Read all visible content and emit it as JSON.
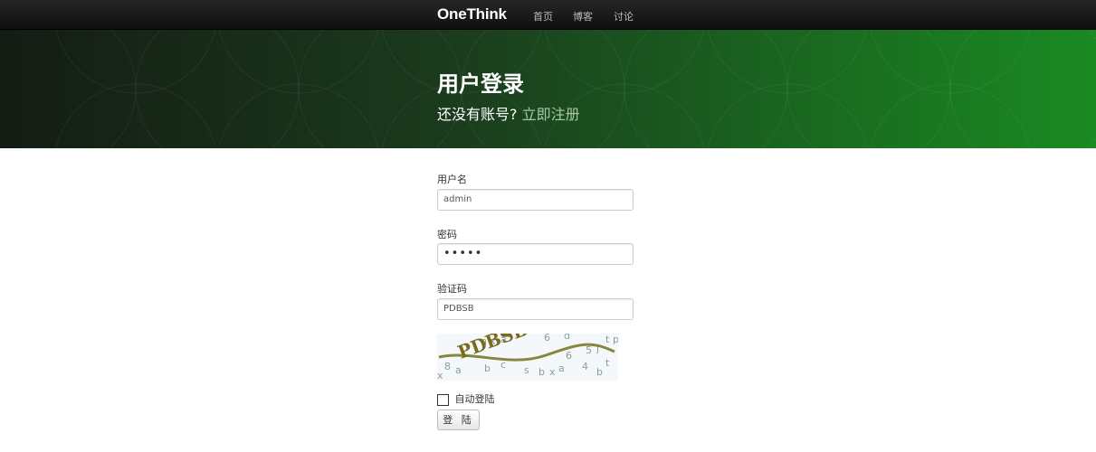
{
  "navbar": {
    "brand": "OneThink",
    "items": [
      "首页",
      "博客",
      "讨论"
    ]
  },
  "hero": {
    "title": "用户登录",
    "subtitle": "还没有账号?",
    "register_link": "立即注册"
  },
  "form": {
    "username_label": "用户名",
    "username_value": "admin",
    "password_label": "密码",
    "password_value": "•••••",
    "captcha_label": "验证码",
    "captcha_value": "PDBSB",
    "captcha_text": "PDBSB",
    "remember_label": "自动登陆",
    "submit_label": "登 陆"
  },
  "colors": {
    "navbar": "#1a1a1a",
    "hero_dark": "#141c14",
    "hero_green": "#1a8a22",
    "link_muted": "#a8c8a8"
  }
}
